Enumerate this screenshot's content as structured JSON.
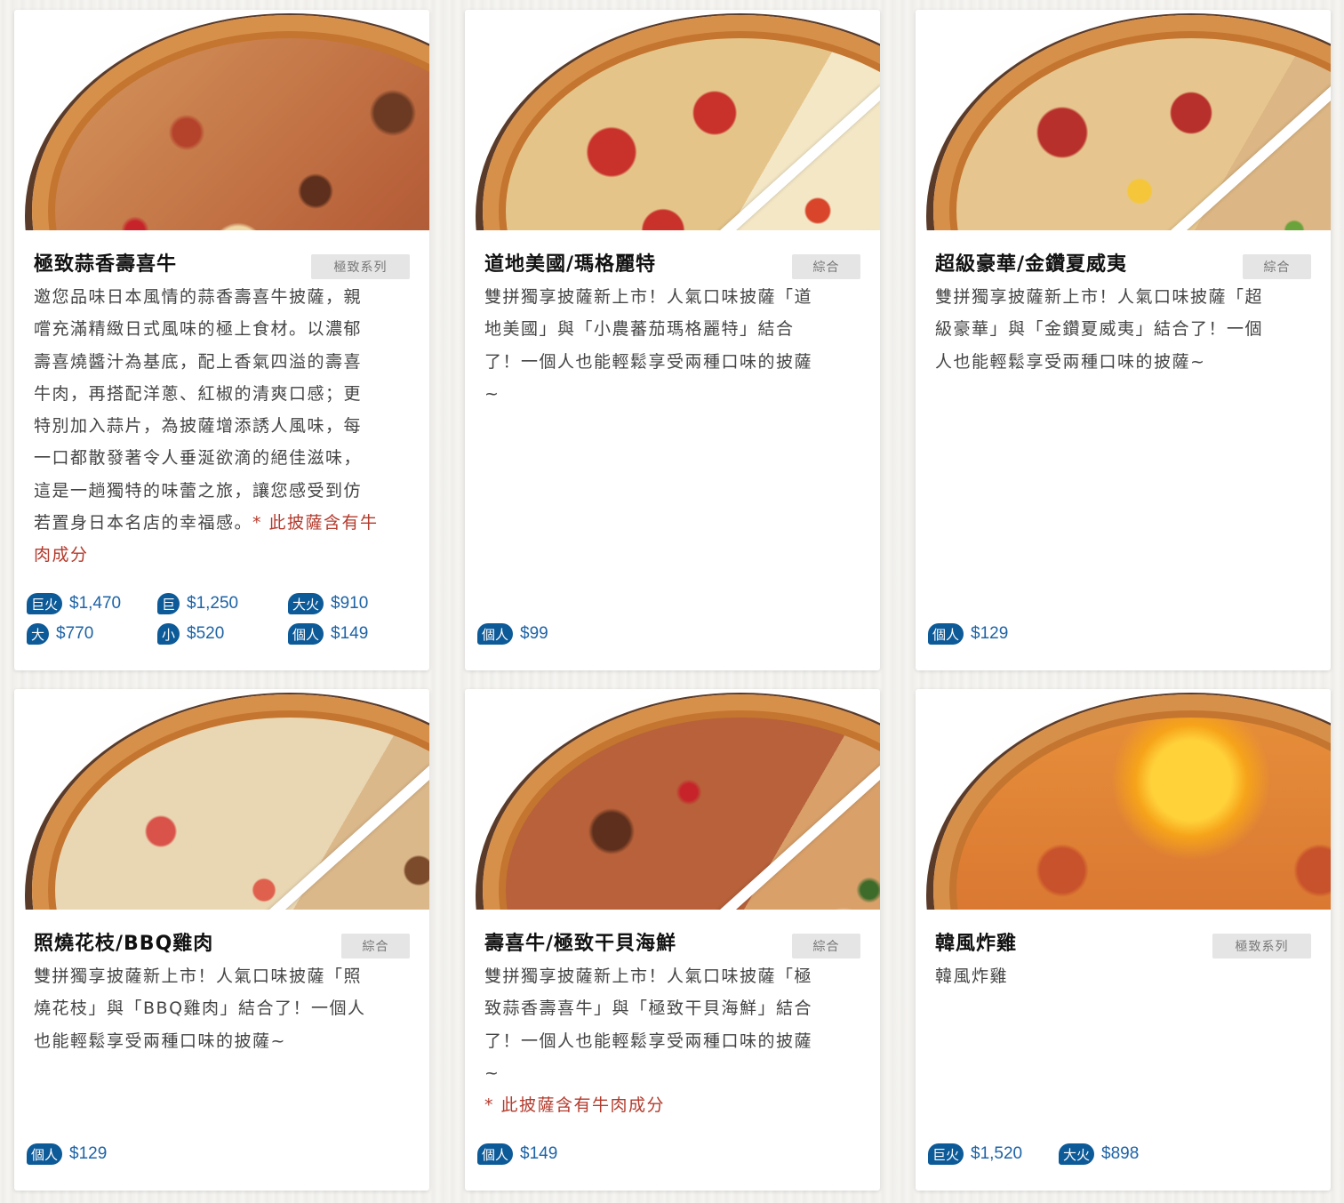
{
  "cards": [
    {
      "title": "極致蒜香壽喜牛",
      "tag": "極致系列",
      "desc_lines": [
        "邀您品味日本風情的蒜香壽喜牛披薩，親",
        "嚐充滿精緻日式風味的極上食材。以濃郁",
        "壽喜燒醬汁為基底，配上香氣四溢的壽喜",
        "牛肉，再搭配洋蔥、紅椒的清爽口感；更",
        "特別加入蒜片，為披薩增添誘人風味，每",
        "一口都散發著令人垂涎欲滴的絕佳滋味，",
        "這是一趟獨特的味蕾之旅，讓您感受到仿"
      ],
      "desc_tail": "若置身日本名店的幸福感。",
      "warn_inline": "* 此披薩含有牛",
      "warn_next": "肉成分",
      "prices": [
        {
          "size": "巨火",
          "price": "$1,470"
        },
        {
          "size": "巨",
          "price": "$1,250"
        },
        {
          "size": "大火",
          "price": "$910"
        },
        {
          "size": "大",
          "price": "$770"
        },
        {
          "size": "小",
          "price": "$520"
        },
        {
          "size": "個人",
          "price": "$149"
        }
      ]
    },
    {
      "title": "道地美國/瑪格麗特",
      "tag": "綜合",
      "desc_lines": [
        "雙拼獨享披薩新上市！人氣口味披薩「道",
        "地美國」與「小農蕃茄瑪格麗特」結合",
        "了！一個人也能輕鬆享受兩種口味的披薩",
        "~"
      ],
      "prices": [
        {
          "size": "個人",
          "price": "$99"
        }
      ]
    },
    {
      "title": "超級豪華/金鑽夏威夷",
      "tag": "綜合",
      "desc_lines": [
        "雙拼獨享披薩新上市！人氣口味披薩「超",
        "級豪華」與「金鑽夏威夷」結合了！一個",
        "人也能輕鬆享受兩種口味的披薩~"
      ],
      "prices": [
        {
          "size": "個人",
          "price": "$129"
        }
      ]
    },
    {
      "title": "照燒花枝/BBQ雞肉",
      "tag": "綜合",
      "desc_lines": [
        "雙拼獨享披薩新上市！人氣口味披薩「照",
        "燒花枝」與「BBQ雞肉」結合了！一個人",
        "也能輕鬆享受兩種口味的披薩~"
      ],
      "prices": [
        {
          "size": "個人",
          "price": "$129"
        }
      ]
    },
    {
      "title": "壽喜牛/極致干貝海鮮",
      "tag": "綜合",
      "desc_lines": [
        "雙拼獨享披薩新上市！人氣口味披薩「極",
        "致蒜香壽喜牛」與「極致干貝海鮮」結合",
        "了！一個人也能輕鬆享受兩種口味的披薩",
        "~"
      ],
      "warn": "* 此披薩含有牛肉成分",
      "prices": [
        {
          "size": "個人",
          "price": "$149"
        }
      ]
    },
    {
      "title": "韓風炸雞",
      "tag": "極致系列",
      "desc_lines": [
        "韓風炸雞"
      ],
      "prices": [
        {
          "size": "巨火",
          "price": "$1,520"
        },
        {
          "size": "大火",
          "price": "$898"
        }
      ]
    }
  ]
}
